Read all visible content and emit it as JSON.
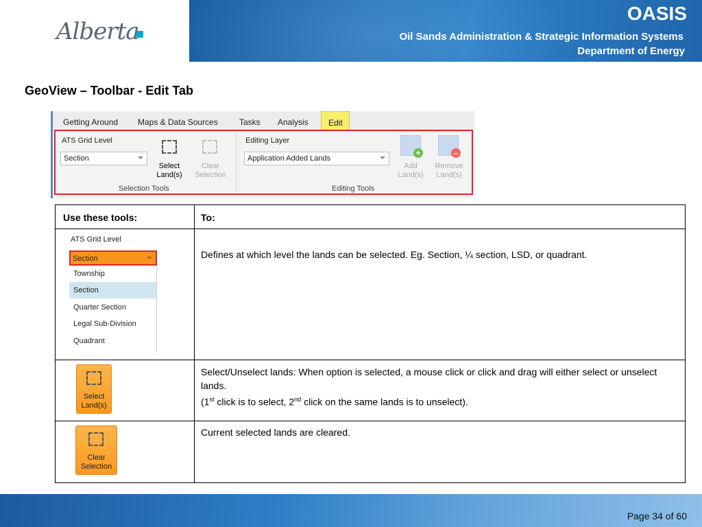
{
  "header": {
    "logo_text": "Alberta",
    "brand": "OASIS",
    "subtitle1": "Oil Sands Administration & Strategic Information Systems",
    "subtitle2": "Department of Energy",
    "colors": {
      "header_blue": "#2a78bf",
      "logo_accent": "#00aad2"
    }
  },
  "page_title": "GeoView – Toolbar - Edit Tab",
  "toolbar": {
    "tabs": [
      "Getting Around",
      "Maps & Data Sources",
      "Tasks",
      "Analysis",
      "Edit"
    ],
    "active_tab": "Edit",
    "ats_label": "ATS Grid Level",
    "ats_value": "Section",
    "select_button": "Select\nLand(s)",
    "select_line1": "Select",
    "select_line2": "Land(s)",
    "clear_line1": "Clear",
    "clear_line2": "Selection",
    "selection_group": "Selection Tools",
    "editing_layer_label": "Editing Layer",
    "editing_layer_value": "Application Added Lands",
    "add_line1": "Add",
    "add_line2": "Land(s)",
    "remove_line1": "Remove",
    "remove_line2": "Land(s)",
    "editing_group": "Editing Tools",
    "colors": {
      "active_tab": "#f7ee6b",
      "highlight_border": "#e0242c"
    }
  },
  "table": {
    "headers": [
      "Use these tools:",
      "To:"
    ],
    "dropdown": {
      "title": "ATS Grid Level",
      "selected": "Section",
      "options": [
        "Township",
        "Section",
        "Quarter Section",
        "Legal Sub-Division",
        "Quadrant"
      ]
    },
    "rows": [
      {
        "text": "Defines at which level the lands can be selected. Eg. Section, ¼ section, LSD, or quadrant."
      },
      {
        "button_line1": "Select",
        "button_line2": "Land(s)",
        "text_line1": "Select/Unselect lands:  When option is selected, a mouse click or click and drag will either select or unselect lands.",
        "text_line2_a": "(1",
        "text_line2_sup1": "st",
        "text_line2_b": " click is to select, 2",
        "text_line2_sup2": "nd",
        "text_line2_c": " click on the same lands is to unselect)."
      },
      {
        "button_line1": "Clear",
        "button_line2": "Selection",
        "text": "Current selected lands are cleared."
      }
    ],
    "colors": {
      "orange_button": "#f79a1f",
      "dropdown_selected": "#cfe6ef"
    }
  },
  "footer": {
    "page": "Page 34 of 60"
  }
}
